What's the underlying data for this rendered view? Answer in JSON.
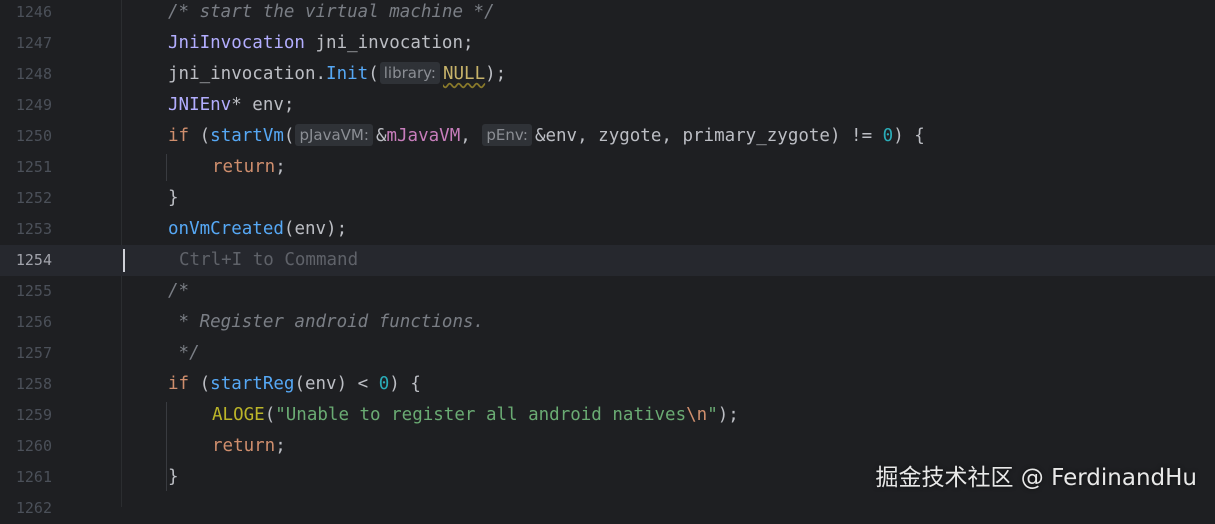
{
  "editor": {
    "lines": [
      {
        "num": "1246",
        "tokens": [
          {
            "t": "/* start the virtual machine */",
            "c": "cm"
          }
        ]
      },
      {
        "num": "1247",
        "tokens": [
          {
            "t": "JniInvocation",
            "c": "type"
          },
          {
            "t": " jni_invocation;",
            "c": ""
          }
        ]
      },
      {
        "num": "1248",
        "tokens": [
          {
            "t": "jni_invocation.",
            "c": ""
          },
          {
            "t": "Init",
            "c": "fn"
          },
          {
            "t": "(",
            "c": ""
          },
          {
            "t": "library:",
            "c": "hint"
          },
          {
            "t": "NULL",
            "c": "null"
          },
          {
            "t": ");",
            "c": ""
          }
        ]
      },
      {
        "num": "1249",
        "tokens": [
          {
            "t": "JNIEnv",
            "c": "type"
          },
          {
            "t": "* env;",
            "c": ""
          }
        ]
      },
      {
        "num": "1250",
        "tokens": [
          {
            "t": "if",
            "c": "kw"
          },
          {
            "t": " (",
            "c": ""
          },
          {
            "t": "startVm",
            "c": "fn"
          },
          {
            "t": "(",
            "c": ""
          },
          {
            "t": "pJavaVM:",
            "c": "hint"
          },
          {
            "t": "&",
            "c": ""
          },
          {
            "t": "mJavaVM",
            "c": "field"
          },
          {
            "t": ", ",
            "c": ""
          },
          {
            "t": "pEnv:",
            "c": "hint"
          },
          {
            "t": "&env, zygote, primary_zygote) != ",
            "c": ""
          },
          {
            "t": "0",
            "c": "num"
          },
          {
            "t": ") {",
            "c": ""
          }
        ]
      },
      {
        "num": "1251",
        "tokens": [
          {
            "t": "return",
            "c": "kw"
          },
          {
            "t": ";",
            "c": ""
          }
        ]
      },
      {
        "num": "1252",
        "tokens": [
          {
            "t": "}",
            "c": ""
          }
        ]
      },
      {
        "num": "1253",
        "tokens": [
          {
            "t": "onVmCreated",
            "c": "fn"
          },
          {
            "t": "(env);",
            "c": ""
          }
        ]
      },
      {
        "num": "1254",
        "tokens": [
          {
            "t": "Ctrl+I to Command",
            "c": "hint-text"
          }
        ]
      },
      {
        "num": "1255",
        "tokens": [
          {
            "t": "/*",
            "c": "cm"
          }
        ]
      },
      {
        "num": "1256",
        "tokens": [
          {
            "t": " * Register android functions.",
            "c": "cm"
          }
        ]
      },
      {
        "num": "1257",
        "tokens": [
          {
            "t": " */",
            "c": "cm"
          }
        ]
      },
      {
        "num": "1258",
        "tokens": [
          {
            "t": "if",
            "c": "kw"
          },
          {
            "t": " (",
            "c": ""
          },
          {
            "t": "startReg",
            "c": "fn"
          },
          {
            "t": "(env) < ",
            "c": ""
          },
          {
            "t": "0",
            "c": "num"
          },
          {
            "t": ") {",
            "c": ""
          }
        ]
      },
      {
        "num": "1259",
        "tokens": [
          {
            "t": "ALOGE",
            "c": "macro"
          },
          {
            "t": "(",
            "c": ""
          },
          {
            "t": "\"Unable to register all android natives",
            "c": "str"
          },
          {
            "t": "\\n",
            "c": "esc"
          },
          {
            "t": "\"",
            "c": "str"
          },
          {
            "t": ");",
            "c": ""
          }
        ]
      },
      {
        "num": "1260",
        "tokens": [
          {
            "t": "return",
            "c": "kw"
          },
          {
            "t": ";",
            "c": ""
          }
        ]
      },
      {
        "num": "1261",
        "tokens": [
          {
            "t": "}",
            "c": ""
          }
        ]
      },
      {
        "num": "1262",
        "tokens": []
      }
    ]
  },
  "watermark": "掘金技术社区 @ FerdinandHu",
  "colors": {
    "background": "#1e1f22",
    "current_line": "#26282e",
    "keyword": "#cf8e6d",
    "function": "#56a8f5",
    "number": "#2aacb8",
    "string": "#6aab73",
    "comment": "#7a7e85"
  }
}
